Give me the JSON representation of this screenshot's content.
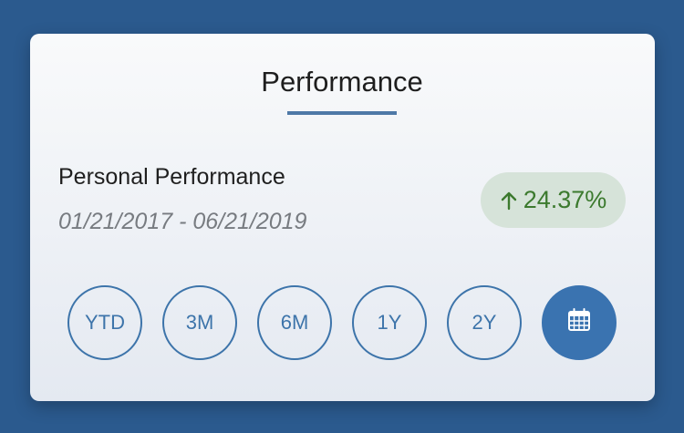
{
  "card": {
    "title": "Performance",
    "label": "Personal Performance",
    "date_range": "01/21/2017 - 06/21/2019",
    "change": {
      "value": "24.37%",
      "direction": "up",
      "icon": "arrow-up-icon",
      "color": "#3c7a2e",
      "bg_color": "#d6e3d9"
    }
  },
  "range_buttons": [
    {
      "label": "YTD"
    },
    {
      "label": "3M"
    },
    {
      "label": "6M"
    },
    {
      "label": "1Y"
    },
    {
      "label": "2Y"
    },
    {
      "icon": "calendar-icon",
      "selected": true
    }
  ],
  "colors": {
    "background": "#2b5a8e",
    "accent": "#3d74aa",
    "underline": "#4e79a7"
  }
}
